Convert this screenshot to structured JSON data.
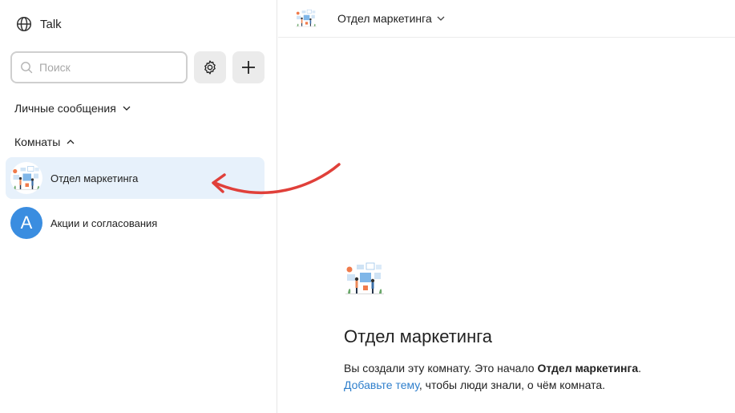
{
  "app": {
    "title": "Talk",
    "icon": "globe-icon"
  },
  "search": {
    "placeholder": "Поиск",
    "value": ""
  },
  "toolbar": {
    "settings_icon": "gear-icon",
    "add_icon": "plus-icon"
  },
  "sections": {
    "direct_messages": {
      "label": "Личные сообщения",
      "expanded": false
    },
    "rooms": {
      "label": "Комнаты",
      "expanded": true
    }
  },
  "rooms": [
    {
      "name": "Отдел маркетинга",
      "avatar": "illustration",
      "active": true
    },
    {
      "name": "Акции и согласования",
      "avatar_letter": "A",
      "active": false
    }
  ],
  "header": {
    "room_name": "Отдел маркетинга"
  },
  "intro": {
    "title": "Отдел маркетинга",
    "text_before": "Вы создали эту комнату. Это начало ",
    "room_name_bold": "Отдел маркетинга",
    "text_after_bold": ".",
    "add_topic_link": "Добавьте тему",
    "text_end": ", чтобы люди знали, о чём комната."
  },
  "colors": {
    "accent": "#2f7fcc",
    "active_bg": "#e7f1fb",
    "avatar_blue": "#3a8de0",
    "annotation_arrow": "#e0403a"
  }
}
